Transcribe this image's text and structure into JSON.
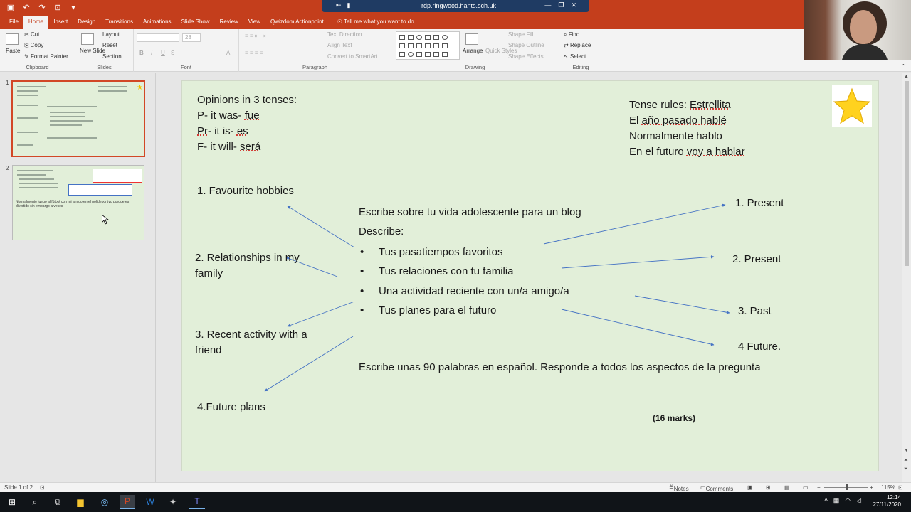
{
  "titlebar": {
    "rdp_host": "rdp.ringwood.hants.sch.uk"
  },
  "ribbon": {
    "tabs": [
      "File",
      "Home",
      "Insert",
      "Design",
      "Transitions",
      "Animations",
      "Slide Show",
      "Review",
      "View",
      "Qwizdom Actionpoint"
    ],
    "active_tab": "Home",
    "tell_me": "Tell me what you want to do...",
    "clipboard": {
      "paste": "Paste",
      "cut": "Cut",
      "copy": "Copy",
      "format_painter": "Format Painter",
      "label": "Clipboard"
    },
    "slides": {
      "new_slide": "New Slide",
      "layout": "Layout",
      "reset": "Reset",
      "section": "Section",
      "label": "Slides"
    },
    "font": {
      "label": "Font",
      "size": "28",
      "bold": "B",
      "italic": "I",
      "underline": "U",
      "strike": "S",
      "font_color": "A"
    },
    "paragraph": {
      "label": "Paragraph",
      "text_direction": "Text Direction",
      "align_text": "Align Text",
      "smartart": "Convert to SmartArt"
    },
    "drawing": {
      "label": "Drawing",
      "arrange": "Arrange",
      "quick_styles": "Quick Styles",
      "shape_fill": "Shape Fill",
      "shape_outline": "Shape Outline",
      "shape_effects": "Shape Effects"
    },
    "editing": {
      "label": "Editing",
      "find": "Find",
      "replace": "Replace",
      "select": "Select"
    }
  },
  "slides_panel": {
    "slide1_number": "1",
    "slide2_number": "2",
    "slide2_text": "Normalmente juego al fútbol con mi amigo en el polideportivo porque es divertido sin embargo a veces"
  },
  "slide": {
    "opinions_title": "Opinions in 3 tenses:",
    "opinion_p_label": "P- it was- ",
    "opinion_p_word": "fue",
    "opinion_pr_label_a": "Pr",
    "opinion_pr_label_b": "- it is- ",
    "opinion_pr_word": "es",
    "opinion_f_label": "F- it will- ",
    "opinion_f_word": "será",
    "tense_rules_label": "Tense rules: ",
    "tense_rules_word": "Estrellita",
    "past_a": "El ",
    "past_b": "año pasado hablé",
    "present": "Normalmente hablo",
    "future_a": "En el futuro ",
    "future_b": "voy a hablar",
    "left_1": "1. Favourite hobbies",
    "left_2": "2. Relationships in my family",
    "left_3": "3. Recent activity with a friend",
    "left_4": "4.Future plans",
    "task_title": "Escribe sobre tu vida adolescente para un blog",
    "describe": "Describe:",
    "bullets": [
      "Tus pasatiempos favoritos",
      "Tus relaciones con tu familia",
      "Una actividad reciente con un/a amigo/a",
      "Tus planes para  el futuro"
    ],
    "right_1": "1. Present",
    "right_2": "2. Present",
    "right_3": "3. Past",
    "right_4": "4 Future.",
    "instruction": "Escribe unas 90 palabras en español. Responde a todos los aspectos de la pregunta",
    "marks": "(16 marks)"
  },
  "statusbar": {
    "slide_of": "Slide 1 of 2",
    "notes": "Notes",
    "comments": "Comments",
    "zoom": "115%"
  },
  "taskbar": {
    "time": "12:14",
    "date": "27/11/2020"
  },
  "colors": {
    "ppt_accent": "#c43e1c",
    "slide_bg": "#e2efd9",
    "arrow": "#4472c4"
  }
}
